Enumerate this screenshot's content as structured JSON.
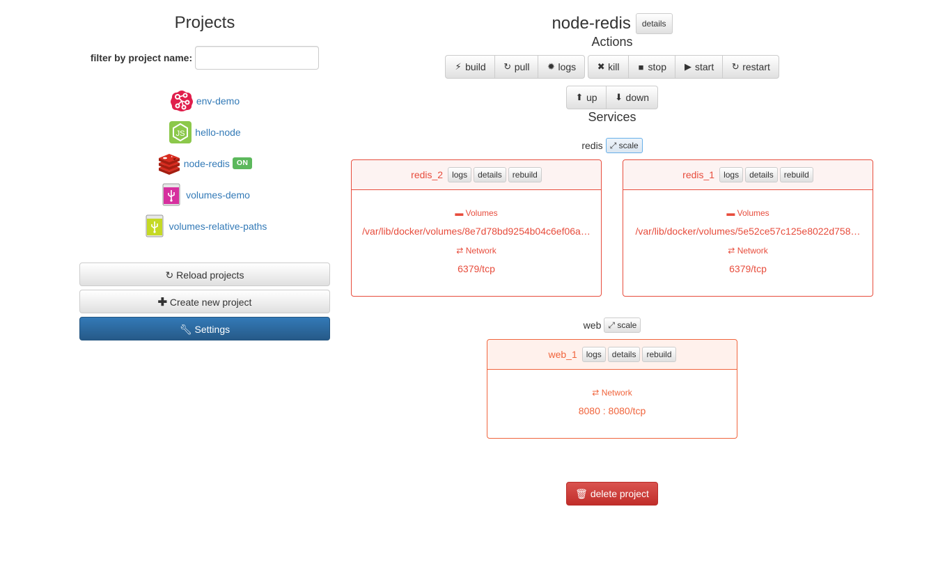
{
  "sidebar": {
    "title": "Projects",
    "filter_label": "filter by project name:",
    "filter_value": "",
    "filter_placeholder": "",
    "projects": [
      {
        "name": "env-demo",
        "icon": "network-nodes-icon",
        "status": ""
      },
      {
        "name": "hello-node",
        "icon": "nodejs-icon",
        "status": ""
      },
      {
        "name": "node-redis",
        "icon": "redis-icon",
        "status": "ON"
      },
      {
        "name": "volumes-demo",
        "icon": "usb-drive-pink-icon",
        "status": ""
      },
      {
        "name": "volumes-relative-paths",
        "icon": "usb-drive-lime-icon",
        "status": ""
      }
    ],
    "buttons": {
      "reload": "Reload projects",
      "create": "Create new project",
      "settings": "Settings"
    }
  },
  "project": {
    "name": "node-redis",
    "details_label": "details",
    "actions_title": "Actions",
    "actions_group1": [
      {
        "label": "build",
        "icon": "bolt-icon"
      },
      {
        "label": "pull",
        "icon": "refresh-icon"
      },
      {
        "label": "logs",
        "icon": "certificate-icon"
      }
    ],
    "actions_group2": [
      {
        "label": "kill",
        "icon": "x-icon"
      },
      {
        "label": "stop",
        "icon": "stop-icon"
      },
      {
        "label": "start",
        "icon": "play-icon"
      },
      {
        "label": "restart",
        "icon": "refresh-icon"
      }
    ],
    "actions_group3": [
      {
        "label": "up",
        "icon": "arrow-up-circle-icon"
      },
      {
        "label": "down",
        "icon": "arrow-down-circle-icon"
      }
    ],
    "services_title": "Services",
    "scale_label": "scale",
    "container_buttons": {
      "logs": "logs",
      "details": "details",
      "rebuild": "rebuild"
    },
    "services": [
      {
        "name": "redis",
        "containers": [
          {
            "name": "redis_2",
            "volumes_label": "Volumes",
            "volume": "/var/lib/docker/volumes/8e7d78bd9254b04c6ef06a…",
            "network_label": "Network",
            "network": "6379/tcp"
          },
          {
            "name": "redis_1",
            "volumes_label": "Volumes",
            "volume": "/var/lib/docker/volumes/5e52ce57c125e8022d758…",
            "network_label": "Network",
            "network": "6379/tcp"
          }
        ]
      },
      {
        "name": "web",
        "containers": [
          {
            "name": "web_1",
            "network_label": "Network",
            "network": "8080 : 8080/tcp"
          }
        ]
      }
    ],
    "delete_label": "delete project"
  },
  "colors": {
    "primary": "#337ab7",
    "success": "#5cb85c",
    "danger": "#d9534f",
    "service_redis": "#e74c3c",
    "service_web": "#f0643c",
    "link": "#337ab7"
  }
}
